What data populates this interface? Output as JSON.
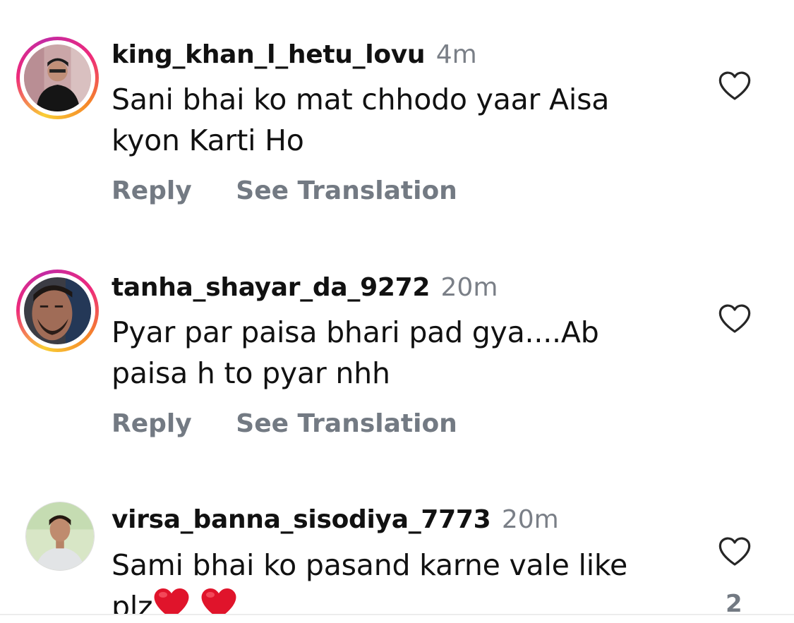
{
  "comments": [
    {
      "username": "king_khan_l_hetu_lovu",
      "time": "4m",
      "text_lines": [
        "Sani bhai ko mat chhodo yaar Aisa",
        "kyon Karti Ho"
      ],
      "reply_label": "Reply",
      "translate_label": "See Translation",
      "has_story_ring": true,
      "avatar_icon": "user-avatar-icon"
    },
    {
      "username": "tanha_shayar_da_9272",
      "time": "20m",
      "text_lines": [
        "Pyar par paisa bhari pad gya....Ab",
        "paisa h to pyar nhh"
      ],
      "reply_label": "Reply",
      "translate_label": "See Translation",
      "has_story_ring": true,
      "avatar_icon": "user-avatar-icon"
    },
    {
      "username": "virsa_banna_sisodiya_7773",
      "time": "20m",
      "text_lines": [
        "Sami bhai ko pasand karne vale like",
        "plz"
      ],
      "trailing_emoji": [
        "red-heart-emoji",
        "red-heart-emoji"
      ],
      "like_count": "2",
      "has_story_ring": false,
      "avatar_icon": "user-avatar-icon"
    }
  ],
  "colors": {
    "username": "#111111",
    "secondary_text": "#737a83",
    "timestamp": "#7a7f87",
    "heart_outline": "#262626",
    "emoji_heart": "#e0142b",
    "story_ring_gradient": [
      "#f9ce34",
      "#ee2a7b",
      "#c32aa3",
      "#f58529"
    ]
  },
  "icons": {
    "like": "heart-outline-icon"
  }
}
